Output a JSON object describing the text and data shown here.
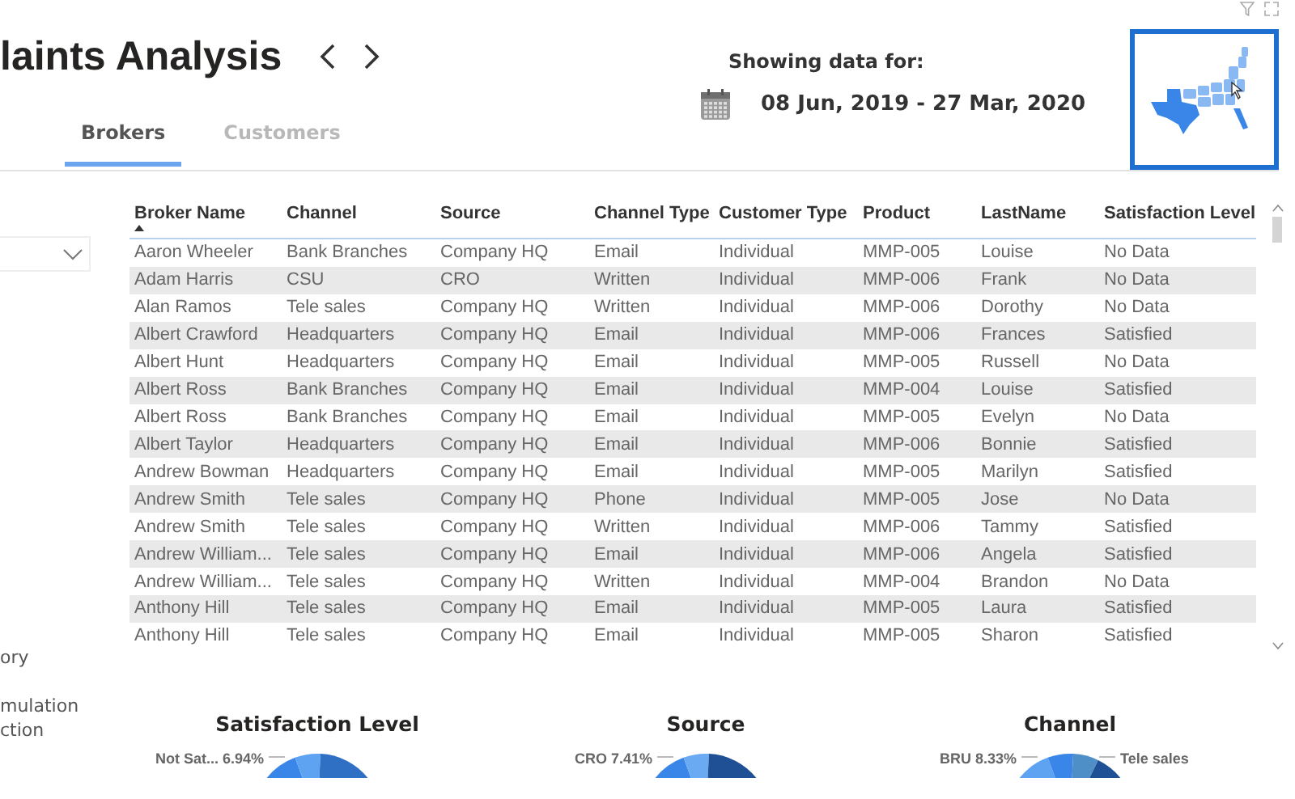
{
  "report": {
    "title": "laints Analysis"
  },
  "tabs": [
    {
      "label": "Brokers",
      "selected": true
    },
    {
      "label": "Customers",
      "selected": false
    }
  ],
  "date_filter": {
    "label": "Showing data for:",
    "range": "08 Jun, 2019 - 27 Mar, 2020"
  },
  "map_visual": {
    "selected": true
  },
  "sidebar": {
    "items": [
      "ory",
      "mulation",
      "ction"
    ]
  },
  "table": {
    "columns": [
      {
        "label": "Broker Name",
        "sorted": true
      },
      {
        "label": "Channel",
        "sorted": false
      },
      {
        "label": "Source",
        "sorted": false
      },
      {
        "label": "Channel Type",
        "sorted": false
      },
      {
        "label": "Customer Type",
        "sorted": false
      },
      {
        "label": "Product",
        "sorted": false
      },
      {
        "label": "LastName",
        "sorted": false
      },
      {
        "label": "Satisfaction Level",
        "sorted": false
      }
    ],
    "rows": [
      [
        "Aaron Wheeler",
        "Bank Branches",
        "Company HQ",
        "Email",
        "Individual",
        "MMP-005",
        "Louise",
        "No Data"
      ],
      [
        "Adam Harris",
        "CSU",
        "CRO",
        "Written",
        "Individual",
        "MMP-006",
        "Frank",
        "No Data"
      ],
      [
        "Alan Ramos",
        "Tele sales",
        "Company HQ",
        "Written",
        "Individual",
        "MMP-006",
        "Dorothy",
        "No Data"
      ],
      [
        "Albert Crawford",
        "Headquarters",
        "Company HQ",
        "Email",
        "Individual",
        "MMP-006",
        "Frances",
        "Satisfied"
      ],
      [
        "Albert Hunt",
        "Headquarters",
        "Company HQ",
        "Email",
        "Individual",
        "MMP-005",
        "Russell",
        "No Data"
      ],
      [
        "Albert Ross",
        "Bank Branches",
        "Company HQ",
        "Email",
        "Individual",
        "MMP-004",
        "Louise",
        "Satisfied"
      ],
      [
        "Albert Ross",
        "Bank Branches",
        "Company HQ",
        "Email",
        "Individual",
        "MMP-005",
        "Evelyn",
        "No Data"
      ],
      [
        "Albert Taylor",
        "Headquarters",
        "Company HQ",
        "Email",
        "Individual",
        "MMP-006",
        "Bonnie",
        "Satisfied"
      ],
      [
        "Andrew Bowman",
        "Headquarters",
        "Company HQ",
        "Email",
        "Individual",
        "MMP-005",
        "Marilyn",
        "Satisfied"
      ],
      [
        "Andrew Smith",
        "Tele sales",
        "Company HQ",
        "Phone",
        "Individual",
        "MMP-005",
        "Jose",
        "No Data"
      ],
      [
        "Andrew Smith",
        "Tele sales",
        "Company HQ",
        "Written",
        "Individual",
        "MMP-006",
        "Tammy",
        "Satisfied"
      ],
      [
        "Andrew William...",
        "Tele sales",
        "Company HQ",
        "Email",
        "Individual",
        "MMP-006",
        "Angela",
        "Satisfied"
      ],
      [
        "Andrew William...",
        "Tele sales",
        "Company HQ",
        "Written",
        "Individual",
        "MMP-004",
        "Brandon",
        "No Data"
      ],
      [
        "Anthony Hill",
        "Tele sales",
        "Company HQ",
        "Email",
        "Individual",
        "MMP-005",
        "Laura",
        "Satisfied"
      ],
      [
        "Anthony Hill",
        "Tele sales",
        "Company HQ",
        "Email",
        "Individual",
        "MMP-005",
        "Sharon",
        "Satisfied"
      ]
    ]
  },
  "charts": [
    {
      "title": "Satisfaction Level",
      "left_label": "Not Sat... 6.94%"
    },
    {
      "title": "Source",
      "left_label": "CRO 7.41%"
    },
    {
      "title": "Channel",
      "left_label": "BRU 8.33%",
      "right_label": "Tele sales"
    }
  ]
}
